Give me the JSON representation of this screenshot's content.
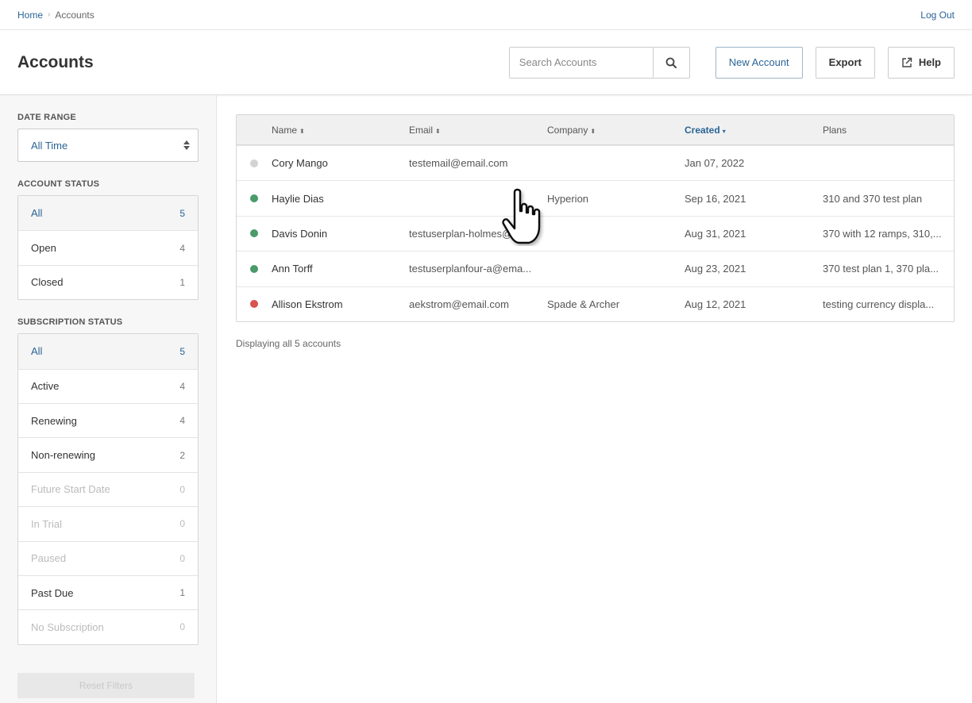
{
  "breadcrumb": {
    "home": "Home",
    "current": "Accounts"
  },
  "top": {
    "logout": "Log Out"
  },
  "header": {
    "title": "Accounts",
    "search_placeholder": "Search Accounts",
    "new_account": "New Account",
    "export": "Export",
    "help": "Help"
  },
  "sidebar": {
    "date_range": {
      "title": "DATE RANGE",
      "value": "All Time"
    },
    "account_status": {
      "title": "ACCOUNT STATUS",
      "items": [
        {
          "label": "All",
          "count": "5"
        },
        {
          "label": "Open",
          "count": "4"
        },
        {
          "label": "Closed",
          "count": "1"
        }
      ]
    },
    "subscription_status": {
      "title": "SUBSCRIPTION STATUS",
      "items": [
        {
          "label": "All",
          "count": "5"
        },
        {
          "label": "Active",
          "count": "4"
        },
        {
          "label": "Renewing",
          "count": "4"
        },
        {
          "label": "Non-renewing",
          "count": "2"
        },
        {
          "label": "Future Start Date",
          "count": "0"
        },
        {
          "label": "In Trial",
          "count": "0"
        },
        {
          "label": "Paused",
          "count": "0"
        },
        {
          "label": "Past Due",
          "count": "1"
        },
        {
          "label": "No Subscription",
          "count": "0"
        }
      ]
    },
    "reset": "Reset Filters"
  },
  "table": {
    "columns": {
      "name": "Name",
      "email": "Email",
      "company": "Company",
      "created": "Created",
      "plans": "Plans"
    },
    "rows": [
      {
        "status_color": "#d3d3d3",
        "name": "Cory Mango",
        "email": "testemail@email.com",
        "company": "",
        "created": "Jan 07, 2022",
        "plans": ""
      },
      {
        "status_color": "#4a9a6a",
        "name": "Haylie Dias",
        "email": "",
        "company": "Hyperion",
        "created": "Sep 16, 2021",
        "plans": "310 and 370 test plan"
      },
      {
        "status_color": "#4a9a6a",
        "name": "Davis Donin",
        "email": "testuserplan-holmes@",
        "company": "",
        "created": "Aug 31, 2021",
        "plans": "370 with 12 ramps, 310,..."
      },
      {
        "status_color": "#4a9a6a",
        "name": "Ann Torff",
        "email": "testuserplanfour-a@ema...",
        "company": "",
        "created": "Aug 23, 2021",
        "plans": "370 test plan 1, 370 pla..."
      },
      {
        "status_color": "#d9534f",
        "name": "Allison Ekstrom",
        "email": "aekstrom@email.com",
        "company": "Spade & Archer",
        "created": "Aug 12, 2021",
        "plans": "testing currency displa..."
      }
    ],
    "footer": "Displaying all 5 accounts"
  }
}
